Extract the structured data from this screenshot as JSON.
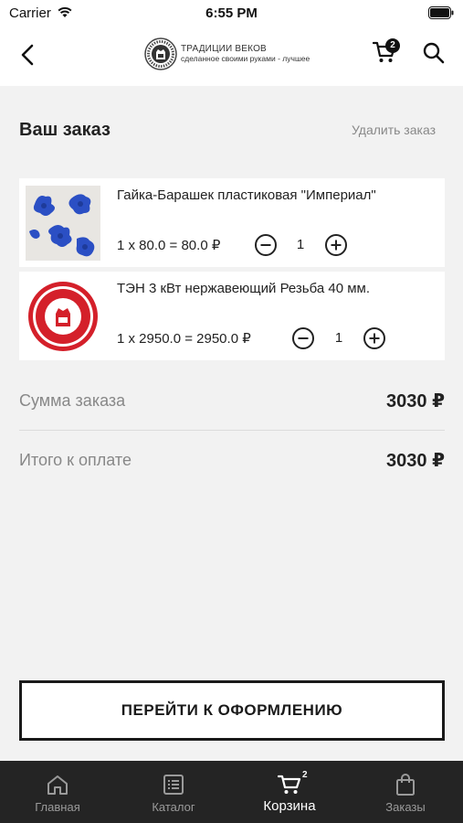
{
  "status_bar": {
    "carrier": "Carrier",
    "time": "6:55 PM"
  },
  "header": {
    "logo_title": "ТРАДИЦИИ ВЕКОВ",
    "logo_subtitle": "сделанное своими руками - лучшее",
    "cart_count": "2",
    "icons": [
      "back-icon",
      "logo-emblem-icon",
      "cart-icon",
      "search-icon"
    ]
  },
  "order": {
    "title": "Ваш заказ",
    "delete_label": "Удалить заказ",
    "items": [
      {
        "name": "Гайка-Барашек пластиковая \"Империал\"",
        "price_line": "1 x 80.0 = 80.0 ₽",
        "quantity": "1",
        "image": "blue-plastic-wing-nuts"
      },
      {
        "name": "ТЭН 3 кВт нержавеющий Резьба 40 мм.",
        "price_line": "1 x 2950.0 = 2950.0 ₽",
        "quantity": "1",
        "image": "tradicii-vekov-red-stamp"
      }
    ]
  },
  "summary": {
    "sum_label": "Сумма заказа",
    "sum_value": "3030 ₽",
    "total_label": "Итого к оплате",
    "total_value": "3030 ₽"
  },
  "checkout": {
    "label": "ПЕРЕЙТИ К ОФОРМЛЕНИЮ"
  },
  "tabbar": {
    "tabs": [
      {
        "label": "Главная",
        "icon": "home-icon",
        "active": false
      },
      {
        "label": "Каталог",
        "icon": "catalog-icon",
        "active": false
      },
      {
        "label": "Корзина",
        "icon": "cart-icon",
        "active": true,
        "badge": "2"
      },
      {
        "label": "Заказы",
        "icon": "bag-icon",
        "active": false
      }
    ]
  },
  "colors": {
    "background": "#f2f2f2",
    "tabbar": "#242424",
    "accent_red": "#d4202a",
    "item_blue": "#2b4fc4",
    "muted_text": "#888888"
  }
}
